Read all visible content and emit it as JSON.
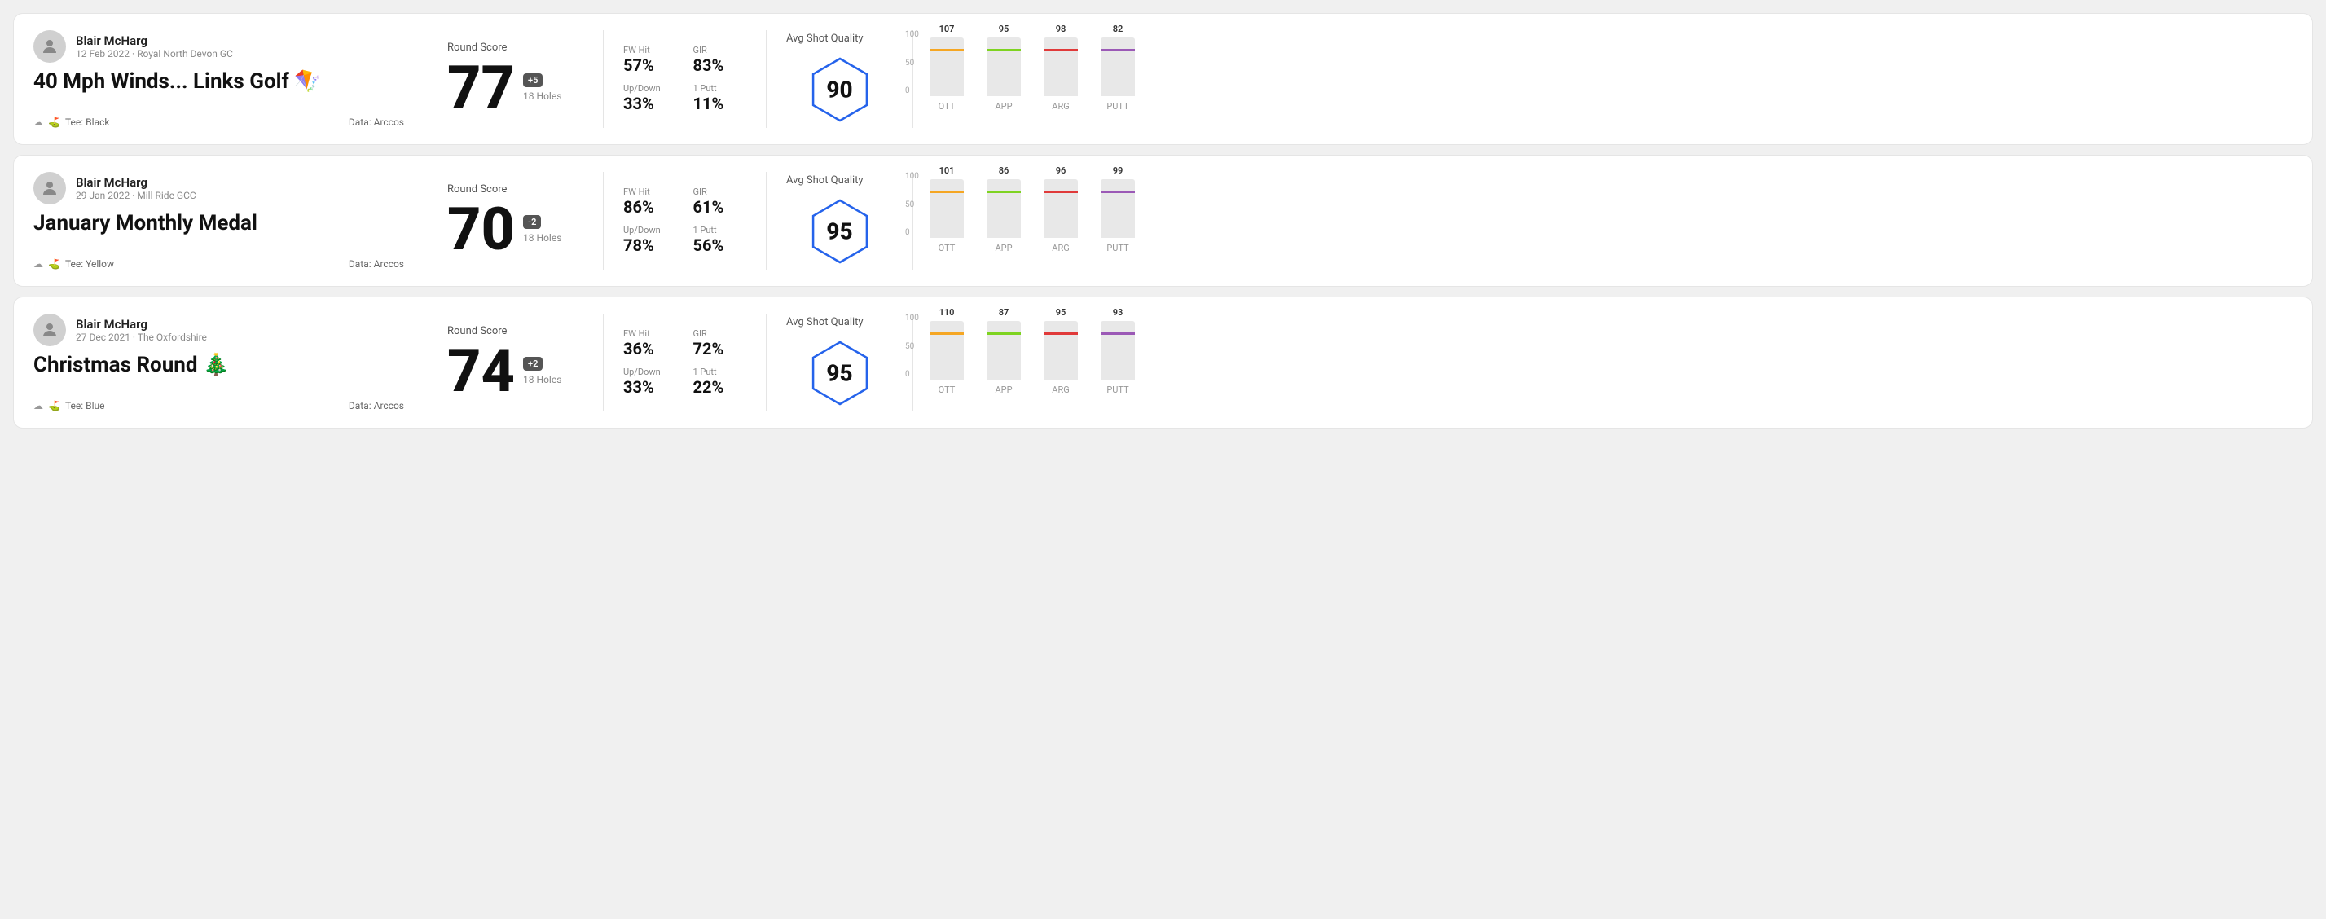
{
  "rounds": [
    {
      "id": "round1",
      "user": {
        "name": "Blair McHarg",
        "meta": "12 Feb 2022 · Royal North Devon GC"
      },
      "title": "40 Mph Winds... Links Golf 🪁",
      "tee": "Black",
      "data_source": "Data: Arccos",
      "score": "77",
      "score_diff": "+5",
      "holes": "18 Holes",
      "fw_hit": "57%",
      "gir": "83%",
      "up_down": "33%",
      "one_putt": "11%",
      "avg_quality": "90",
      "chart": {
        "bars": [
          {
            "label": "OTT",
            "value": 107,
            "color": "#f5a623",
            "max": 130
          },
          {
            "label": "APP",
            "value": 95,
            "color": "#7ed321",
            "max": 130
          },
          {
            "label": "ARG",
            "value": 98,
            "color": "#e03a3a",
            "max": 130
          },
          {
            "label": "PUTT",
            "value": 82,
            "color": "#9b59b6",
            "max": 130
          }
        ]
      }
    },
    {
      "id": "round2",
      "user": {
        "name": "Blair McHarg",
        "meta": "29 Jan 2022 · Mill Ride GCC"
      },
      "title": "January Monthly Medal",
      "tee": "Yellow",
      "data_source": "Data: Arccos",
      "score": "70",
      "score_diff": "-2",
      "holes": "18 Holes",
      "fw_hit": "86%",
      "gir": "61%",
      "up_down": "78%",
      "one_putt": "56%",
      "avg_quality": "95",
      "chart": {
        "bars": [
          {
            "label": "OTT",
            "value": 101,
            "color": "#f5a623",
            "max": 130
          },
          {
            "label": "APP",
            "value": 86,
            "color": "#7ed321",
            "max": 130
          },
          {
            "label": "ARG",
            "value": 96,
            "color": "#e03a3a",
            "max": 130
          },
          {
            "label": "PUTT",
            "value": 99,
            "color": "#9b59b6",
            "max": 130
          }
        ]
      }
    },
    {
      "id": "round3",
      "user": {
        "name": "Blair McHarg",
        "meta": "27 Dec 2021 · The Oxfordshire"
      },
      "title": "Christmas Round 🎄",
      "tee": "Blue",
      "data_source": "Data: Arccos",
      "score": "74",
      "score_diff": "+2",
      "holes": "18 Holes",
      "fw_hit": "36%",
      "gir": "72%",
      "up_down": "33%",
      "one_putt": "22%",
      "avg_quality": "95",
      "chart": {
        "bars": [
          {
            "label": "OTT",
            "value": 110,
            "color": "#f5a623",
            "max": 130
          },
          {
            "label": "APP",
            "value": 87,
            "color": "#7ed321",
            "max": 130
          },
          {
            "label": "ARG",
            "value": 95,
            "color": "#e03a3a",
            "max": 130
          },
          {
            "label": "PUTT",
            "value": 93,
            "color": "#9b59b6",
            "max": 130
          }
        ]
      }
    }
  ],
  "y_axis_labels": [
    "100",
    "50",
    "0"
  ]
}
